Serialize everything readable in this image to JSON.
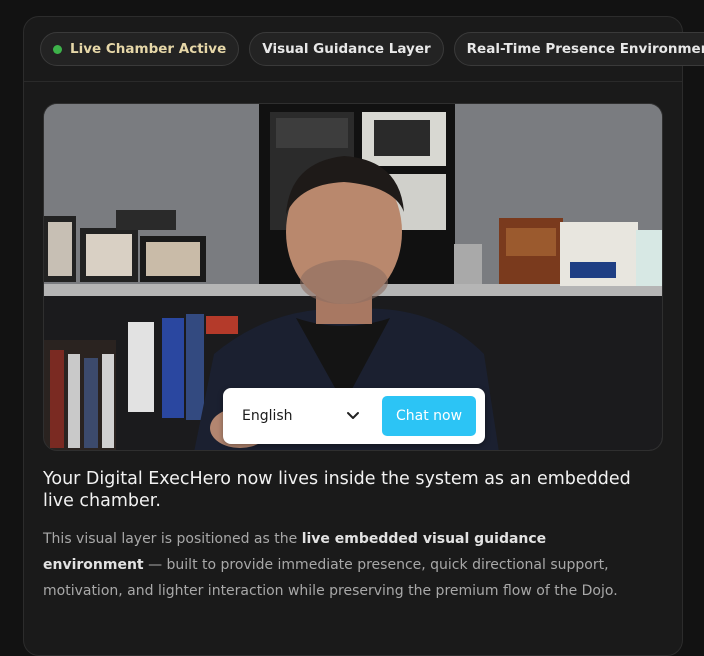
{
  "status_pills": [
    {
      "label": "Live Chamber Active",
      "indicator_color": "#3db24a"
    },
    {
      "label": "Visual Guidance Layer"
    },
    {
      "label": "Real-Time Presence Environment"
    }
  ],
  "video": {
    "language_select": {
      "value": "English",
      "icon": "chevron-down-icon"
    },
    "chat_button": {
      "label": "Chat now",
      "color": "#2cc4f5"
    }
  },
  "headline": "Your Digital ExecHero now lives inside the system as an embedded live chamber.",
  "description": {
    "before": "This visual layer is positioned as the ",
    "emphasis": "live embedded visual guidance environment",
    "after": " — built to provide immediate presence, quick directional support, motivation, and lighter interaction while preserving the premium flow of the Dojo."
  }
}
